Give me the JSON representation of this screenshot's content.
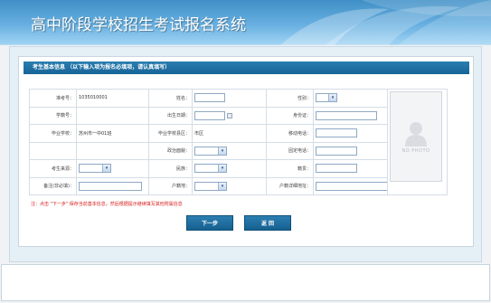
{
  "header": {
    "title": "高中阶段学校招生考试报名系统"
  },
  "panel": {
    "title": "考生基本信息  （以下输入项为报名必填项，请认真填写）"
  },
  "form": {
    "exam_no_label": "准考号：",
    "exam_no_value": "1035010001",
    "name_label": "姓名：",
    "name_value": "",
    "gender_label": "性别：",
    "gender_value": "",
    "student_id_label": "学籍号：",
    "student_id_value": "",
    "birth_label": "出生日期：",
    "birth_value": "",
    "id_card_label": "身份证：",
    "id_card_value": "",
    "school_label": "毕业学校：",
    "school_value": "苏州市一中01班",
    "school_district_label": "毕业学校县区：",
    "school_district_value": "市区",
    "mobile_label": "移动电话：",
    "mobile_value": "",
    "political_label": "政治面貌：",
    "political_value": "",
    "phone_label": "固定电话：",
    "phone_value": "",
    "source_label": "考生来源：",
    "source_value": "",
    "ethnic_label": "民族：",
    "ethnic_value": "",
    "native_label": "籍贯：",
    "native_value": "",
    "remark_label": "备注(非必填)：",
    "remark_value": "",
    "hukou_label": "户籍地：",
    "hukou_value": "",
    "hukou_detail_label": "户籍详细地址：",
    "hukou_detail_value": ""
  },
  "photo": {
    "label": "NO PHOTO"
  },
  "note": "注：点击 \"下一步\" 保存当前基本信息，然后根据提示继续填写其他附属信息",
  "buttons": {
    "next": "下一步",
    "back": "返 回"
  }
}
